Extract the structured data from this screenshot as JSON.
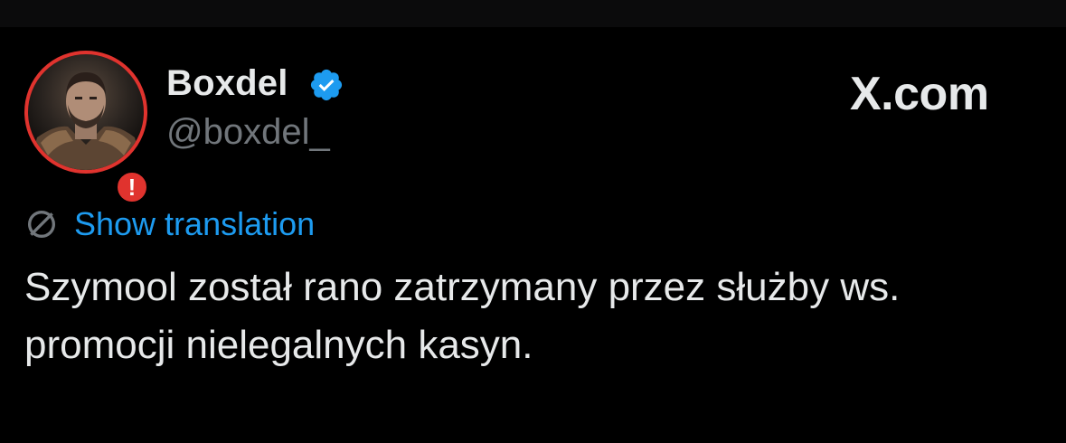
{
  "tweet": {
    "author": {
      "display_name": "Boxdel",
      "handle": "@boxdel_",
      "verified": true,
      "verified_icon": "verified-badge-icon",
      "avatar_alert_icon": "alert-badge-icon",
      "avatar_alert_symbol": "!"
    },
    "brand": "X.com",
    "translation": {
      "icon": "globe-icon",
      "label": "Show translation"
    },
    "text_lines": [
      "Szymool został rano zatrzymany przez służby ws.",
      "promocji nielegalnych kasyn."
    ]
  },
  "colors": {
    "background": "#000000",
    "text_primary": "#e7e9ea",
    "text_secondary": "#71767b",
    "link_blue": "#1d9bf0",
    "verified_blue": "#1d9bf0",
    "alert_red": "#e0332e"
  }
}
